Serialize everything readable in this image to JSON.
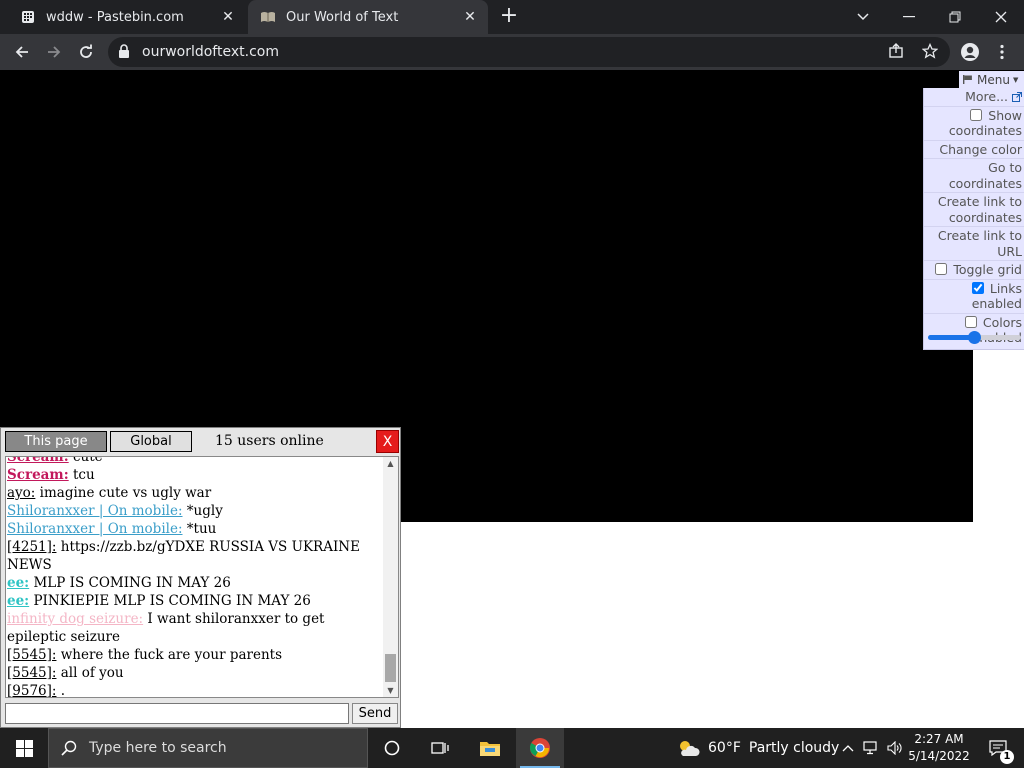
{
  "browser": {
    "tabs": [
      {
        "title": "wddw - Pastebin.com",
        "icon": "pastebin-favicon",
        "active": false
      },
      {
        "title": "Our World of Text",
        "icon": "owot-favicon",
        "active": true
      }
    ],
    "url": "ourworldoftext.com"
  },
  "owot_menu": {
    "header": "Menu",
    "items": [
      {
        "label": "More...",
        "type": "link"
      },
      {
        "label": "Show coordinates",
        "type": "checkbox",
        "checked": false
      },
      {
        "label": "Change color",
        "type": "action"
      },
      {
        "label": "Go to coordinates",
        "type": "action"
      },
      {
        "label": "Create link to coordinates",
        "type": "action"
      },
      {
        "label": "Create link to URL",
        "type": "action"
      },
      {
        "label": "Toggle grid",
        "type": "checkbox",
        "checked": false
      },
      {
        "label": "Links enabled",
        "type": "checkbox",
        "checked": true
      },
      {
        "label": "Colors enabled",
        "type": "checkbox",
        "checked": false
      }
    ],
    "zoom_slider_value": 0.5
  },
  "chat": {
    "tab_this_page": "This page",
    "tab_global": "Global",
    "users_online": "15 users online",
    "close_label": "X",
    "send_label": "Send",
    "input_value": "",
    "messages": [
      {
        "nick": "Scream:",
        "text": " cute",
        "color": "#c2185b",
        "bold": true
      },
      {
        "nick": "Scream:",
        "text": " tcu",
        "color": "#c2185b",
        "bold": true
      },
      {
        "nick": "ayo:",
        "text": " imagine cute vs ugly war",
        "color": "#000000",
        "bold": false
      },
      {
        "nick": "Shiloranxxer | On mobile:",
        "text": " *ugly",
        "color": "#3a9ec9",
        "bold": false
      },
      {
        "nick": "Shiloranxxer | On mobile:",
        "text": " *tuu",
        "color": "#3a9ec9",
        "bold": false
      },
      {
        "nick": "[4251]:",
        "text": " https://zzb.bz/gYDXE RUSSIA VS UKRAINE NEWS",
        "color": "#000000",
        "bold": false
      },
      {
        "nick": "ee:",
        "text": " MLP IS COMING IN MAY 26",
        "color": "#2ec4c4",
        "bold": true
      },
      {
        "nick": "ee:",
        "text": " PINKIEPIE MLP IS COMING IN MAY 26",
        "color": "#2ec4c4",
        "bold": true
      },
      {
        "nick": "infinity dog seizure:",
        "text": " I want shiloranxxer to get epileptic seizure",
        "color": "#f4b6c6",
        "bold": false
      },
      {
        "nick": "[5545]:",
        "text": " where the fuck are your parents",
        "color": "#000000",
        "bold": false
      },
      {
        "nick": "[5545]:",
        "text": " all of you",
        "color": "#000000",
        "bold": false
      },
      {
        "nick": "[9576]:",
        "text": " .",
        "color": "#000000",
        "bold": false
      }
    ]
  },
  "taskbar": {
    "search_placeholder": "Type here to search",
    "weather_temp": "60°F",
    "weather_text": "Partly cloudy",
    "time": "2:27 AM",
    "date": "5/14/2022",
    "notification_count": "1"
  }
}
